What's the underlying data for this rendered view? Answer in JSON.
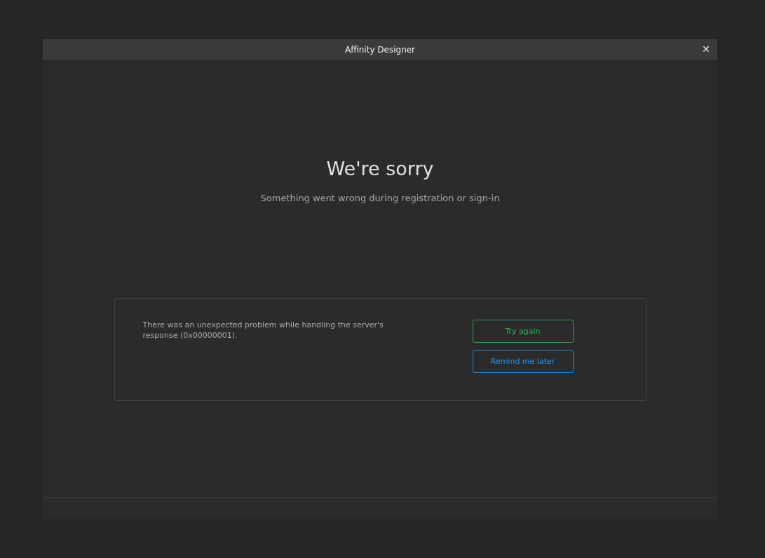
{
  "window": {
    "title": "Affinity Designer",
    "close": "✕"
  },
  "heading": "We're sorry",
  "subtitle": "Something went wrong during registration or sign-in",
  "error": {
    "message": "There was an unexpected problem while handling the server's response (0x00000001).",
    "buttons": [
      {
        "label": "Try again",
        "kind": "retry"
      },
      {
        "label": "Remind me later",
        "kind": "later"
      }
    ]
  }
}
